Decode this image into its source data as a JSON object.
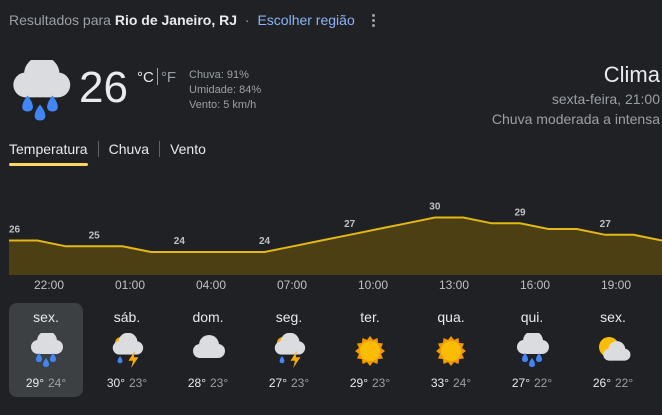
{
  "location": {
    "prefix": "Resultados para",
    "city": "Rio de Janeiro, RJ",
    "separator": "·",
    "change_link": "Escolher região"
  },
  "current": {
    "icon": "rain-cloud-icon",
    "temperature": "26",
    "unit_c": "°C",
    "unit_f": "°F",
    "precip": "Chuva: 91%",
    "humidity": "Umidade: 84%",
    "wind": "Vento: 5 km/h"
  },
  "summary": {
    "title": "Clima",
    "datetime": "sexta-feira, 21:00",
    "condition": "Chuva moderada a intensa"
  },
  "tabs": [
    {
      "label": "Temperatura",
      "active": true
    },
    {
      "label": "Chuva",
      "active": false
    },
    {
      "label": "Vento",
      "active": false
    }
  ],
  "colors": {
    "accent": "#fdd663",
    "chart_line": "#e3b715",
    "chart_fill": "#4d3f14",
    "link": "#8ab4f8"
  },
  "chart_data": {
    "type": "area",
    "x": [
      "22:00",
      "23:00",
      "00:00",
      "01:00",
      "02:00",
      "03:00",
      "04:00",
      "05:00",
      "06:00",
      "07:00",
      "08:00",
      "09:00",
      "10:00",
      "11:00",
      "12:00",
      "13:00",
      "14:00",
      "15:00",
      "16:00",
      "17:00",
      "18:00",
      "19:00",
      "20:00",
      "21:00"
    ],
    "values": [
      26,
      26,
      25,
      25,
      25,
      24,
      24,
      24,
      24,
      24,
      25,
      26,
      27,
      28,
      29,
      30,
      30,
      29,
      29,
      28,
      28,
      27,
      27,
      26
    ],
    "labels": [
      {
        "index": 0,
        "text": "26"
      },
      {
        "index": 3,
        "text": "25"
      },
      {
        "index": 6,
        "text": "24"
      },
      {
        "index": 9,
        "text": "24"
      },
      {
        "index": 12,
        "text": "27"
      },
      {
        "index": 15,
        "text": "30"
      },
      {
        "index": 18,
        "text": "29"
      },
      {
        "index": 21,
        "text": "27"
      }
    ],
    "tick_labels": [
      "22:00",
      "01:00",
      "04:00",
      "07:00",
      "10:00",
      "13:00",
      "16:00",
      "19:00"
    ],
    "ylim": [
      20,
      32
    ]
  },
  "forecast": [
    {
      "day": "sex.",
      "icon": "rain-cloud-icon",
      "high": "29°",
      "low": "24°",
      "active": true
    },
    {
      "day": "sáb.",
      "icon": "thunderstorm-icon",
      "high": "30°",
      "low": "23°",
      "active": false
    },
    {
      "day": "dom.",
      "icon": "cloud-icon",
      "high": "28°",
      "low": "23°",
      "active": false
    },
    {
      "day": "seg.",
      "icon": "thunderstorm-icon",
      "high": "27°",
      "low": "23°",
      "active": false
    },
    {
      "day": "ter.",
      "icon": "sun-icon",
      "high": "29°",
      "low": "23°",
      "active": false
    },
    {
      "day": "qua.",
      "icon": "sun-icon",
      "high": "33°",
      "low": "24°",
      "active": false
    },
    {
      "day": "qui.",
      "icon": "rain-cloud-icon",
      "high": "27°",
      "low": "22°",
      "active": false
    },
    {
      "day": "sex.",
      "icon": "partly-cloudy-icon",
      "high": "26°",
      "low": "22°",
      "active": false
    }
  ]
}
